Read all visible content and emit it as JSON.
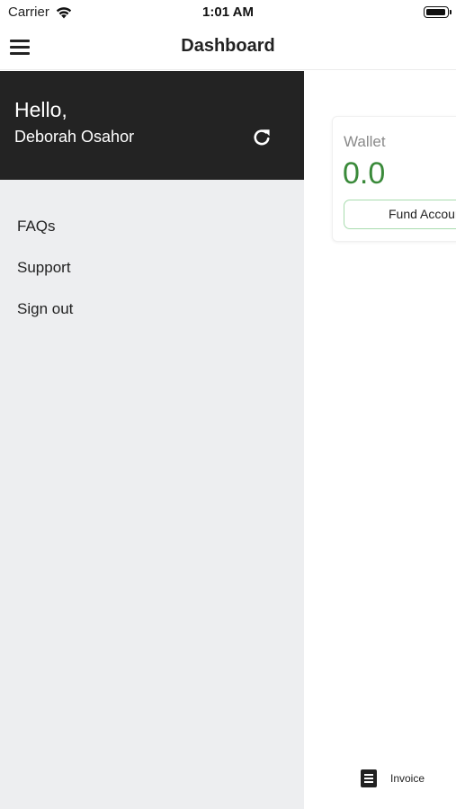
{
  "status_bar": {
    "carrier": "Carrier",
    "time": "1:01 AM"
  },
  "header": {
    "title": "Dashboard",
    "menu_icon": "hamburger-menu-icon"
  },
  "drawer": {
    "greeting": "Hello,",
    "user_name": "Deborah Osahor",
    "refresh_icon": "refresh-icon",
    "header_bg": "#232323",
    "bg": "#edeef0",
    "items": [
      {
        "label": "FAQs"
      },
      {
        "label": "Support"
      },
      {
        "label": "Sign out"
      }
    ]
  },
  "wallet": {
    "label": "Wallet",
    "amount": "0.0",
    "amount_color": "#3a8a3a",
    "fund_button": "Fund Account"
  },
  "tab_bar": {
    "invoice_label": "Invoice",
    "invoice_icon": "invoice-icon"
  }
}
